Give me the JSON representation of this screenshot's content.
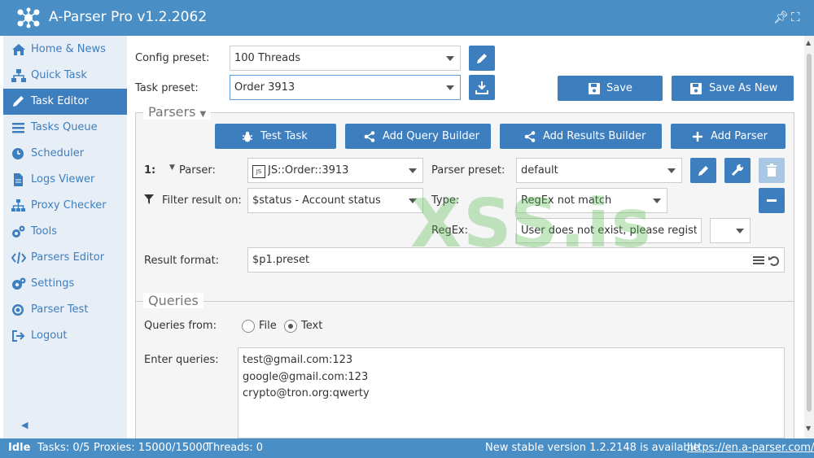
{
  "app": {
    "title": "A-Parser Pro v1.2.2062"
  },
  "sidebar": {
    "items": [
      {
        "label": "Home & News",
        "icon": "home-icon"
      },
      {
        "label": "Quick Task",
        "icon": "sitemap-icon"
      },
      {
        "label": "Task Editor",
        "icon": "pencil-icon",
        "active": true
      },
      {
        "label": "Tasks Queue",
        "icon": "list-icon"
      },
      {
        "label": "Scheduler",
        "icon": "clock-icon"
      },
      {
        "label": "Logs Viewer",
        "icon": "file-icon"
      },
      {
        "label": "Proxy Checker",
        "icon": "network-icon"
      },
      {
        "label": "Tools",
        "icon": "gears-icon"
      },
      {
        "label": "Parsers Editor",
        "icon": "code-icon"
      },
      {
        "label": "Settings",
        "icon": "cogs-icon"
      },
      {
        "label": "Parser Test",
        "icon": "target-icon"
      },
      {
        "label": "Logout",
        "icon": "sign-out-icon"
      }
    ]
  },
  "config": {
    "config_preset_label": "Config preset:",
    "config_preset_value": "100 Threads",
    "task_preset_label": "Task preset:",
    "task_preset_value": "Order 3913",
    "save_label": "Save",
    "save_as_new_label": "Save As New"
  },
  "parsers": {
    "legend": "Parsers",
    "test_task_label": "Test Task",
    "add_query_builder_label": "Add Query Builder",
    "add_results_builder_label": "Add Results Builder",
    "add_parser_label": "Add Parser",
    "row_number": "1:",
    "parser_label": "Parser:",
    "parser_value": "JS::Order::3913",
    "parser_badge": "JS",
    "parser_preset_label": "Parser preset:",
    "parser_preset_value": "default",
    "filter_label": "Filter result on:",
    "filter_value": "$status - Account status",
    "type_label": "Type:",
    "type_value": "RegEx not match",
    "regex_label": "RegEx:",
    "regex_value": "User does not exist, please register f",
    "result_format_label": "Result format:",
    "result_format_value": "$p1.preset"
  },
  "queries": {
    "legend": "Queries",
    "from_label": "Queries from:",
    "option_file": "File",
    "option_text": "Text",
    "selected": "Text",
    "enter_label": "Enter queries:",
    "lines": [
      "test@gmail.com:123",
      "google@gmail.com:123",
      "crypto@tron.org:qwerty"
    ]
  },
  "status": {
    "state": "Idle",
    "tasks": "Tasks: 0/5",
    "proxies": "Proxies: 15000/15000",
    "threads": "Threads: 0",
    "update_notice": "New stable version 1.2.2148 is available",
    "update_link": "https://en.a-parser.com/"
  },
  "watermark": "XSS.is",
  "colors": {
    "primary": "#3d7ebf",
    "titlebar": "#4a8ec6",
    "sidebar_bg": "#e8eef5",
    "watermark": "#5abe50"
  }
}
